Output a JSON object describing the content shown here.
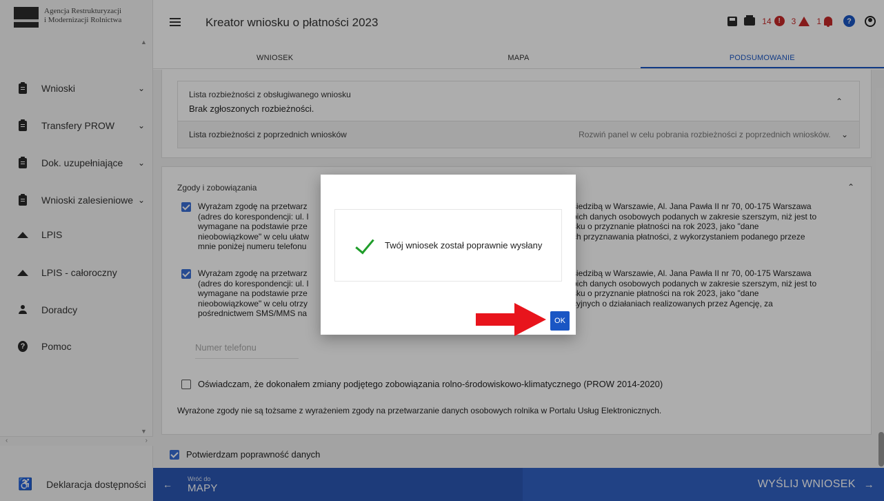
{
  "logo": {
    "line1": "Agencja Restrukturyzacji",
    "line2": "i Modernizacji Rolnictwa"
  },
  "sidebar": {
    "items": [
      {
        "label": "Wnioski",
        "icon": "clipboard-icon",
        "has_chevron": true
      },
      {
        "label": "Transfery PROW",
        "icon": "clipboard-icon",
        "has_chevron": true
      },
      {
        "label": "Dok. uzupełniające",
        "icon": "clipboard-icon",
        "has_chevron": true
      },
      {
        "label": "Wnioski zalesieniowe",
        "icon": "clipboard-icon",
        "has_chevron": true
      },
      {
        "label": "LPIS",
        "icon": "terrain-icon",
        "has_chevron": false
      },
      {
        "label": "LPIS - całoroczny",
        "icon": "terrain-icon",
        "has_chevron": false
      },
      {
        "label": "Doradcy",
        "icon": "person-icon",
        "has_chevron": false
      },
      {
        "label": "Pomoc",
        "icon": "help-icon",
        "has_chevron": false
      }
    ],
    "footer_label": "Deklaracja dostępności"
  },
  "header": {
    "title": "Kreator wniosku o płatności 2023",
    "error_count": "14",
    "warning_count": "3",
    "notification_count": "1",
    "colors": {
      "alert": "#c62828",
      "accent": "#1a56c4"
    }
  },
  "tabs": [
    {
      "label": "WNIOSEK",
      "active": false
    },
    {
      "label": "MAPA",
      "active": false
    },
    {
      "label": "PODSUMOWANIE",
      "active": true
    }
  ],
  "discrepancies": {
    "current_title": "Lista rozbieżności z obsługiwanego wniosku",
    "current_value": "Brak zgłoszonych rozbieżności.",
    "previous_title": "Lista rozbieżności z poprzednich wniosków",
    "previous_hint": "Rozwiń panel w celu pobrania rozbieżności z poprzednich wniosków."
  },
  "consents": {
    "title": "Zgody i zobowiązania",
    "consent1": {
      "checked": true,
      "lines": [
        "Wyrażam zgodę na przetwarz",
        "(adres do korespondencji: ul. I",
        "wymagane na podstawie prze",
        "nieobowiązkowe\" w celu ułatw",
        "mnie poniżej numeru telefonu"
      ],
      "right_lines": [
        "siedzibą w Warszawie, Al. Jana Pawła II nr 70, 00-175 Warszawa",
        "bich danych osobowych podanych w zakresie szerszym, niż jest to",
        "sku o przyznanie płatności na rok 2023, jako \"dane",
        "ch przyznawania płatności, z wykorzystaniem podanego przeze"
      ]
    },
    "consent2": {
      "checked": true,
      "lines": [
        "Wyrażam zgodę na przetwarz",
        "(adres do korespondencji: ul. I",
        "wymagane na podstawie prze",
        "nieobowiązkowe\" w celu otrzy",
        "pośrednictwem SMS/MMS na"
      ],
      "right_lines": [
        "siedzibą w Warszawie, Al. Jana Pawła II nr 70, 00-175 Warszawa",
        "bich danych osobowych podanych w zakresie szerszym, niż jest to",
        "sku o przyznanie płatności na rok 2023, jako \"dane",
        "cyjnych o działaniach realizowanych przez Agencję, za"
      ]
    },
    "phone_placeholder": "Numer telefonu",
    "consent3": {
      "checked": false,
      "label": "Oświadczam, że dokonałem zmiany podjętego zobowiązania rolno-środowiskowo-klimatycznego (PROW 2014-2020)"
    },
    "note": "Wyrażone zgody nie są tożsame z wyrażeniem zgody na przetwarzanie danych osobowych rolnika w Portalu Usług Elektronicznych."
  },
  "confirm": {
    "checked": true,
    "label": "Potwierdzam poprawność danych"
  },
  "footer": {
    "back_small": "Wróć do",
    "back_large": "MAPY",
    "submit": "WYŚLIJ WNIOSEK"
  },
  "dialog": {
    "message": "Twój wniosek został poprawnie wysłany",
    "ok_label": "OK",
    "success_color": "#1f9d2a",
    "annotation_arrow_color": "#e8141c"
  }
}
